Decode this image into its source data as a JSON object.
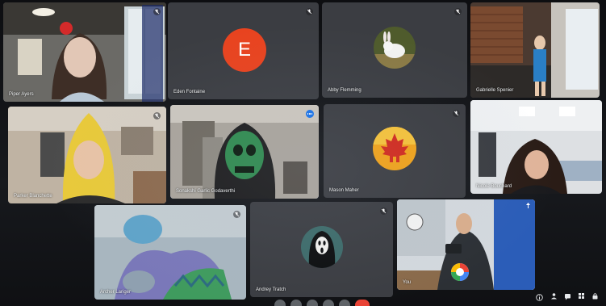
{
  "participants": [
    {
      "name": "Piper Ayers"
    },
    {
      "name": "Eden Fontaine",
      "avatar_letter": "E"
    },
    {
      "name": "Abby Flemming"
    },
    {
      "name": "Gabrielle Spenier"
    },
    {
      "name": "Parker Blanchette"
    },
    {
      "name": "Sonakshi Garlic Godaverthi"
    },
    {
      "name": "Mason Maher"
    },
    {
      "name": "Nicole Bouchard"
    },
    {
      "name": "Archer Lariger"
    },
    {
      "name": "Andrey Tratch"
    },
    {
      "name": "You"
    }
  ],
  "colors": {
    "accent": "#1a73e8",
    "avatar_orange": "#e8431f",
    "end_call_red": "#ea4335",
    "tile_bg": "#3b3d42"
  },
  "icons": [
    "mic-off-icon",
    "more-options-icon",
    "info-icon",
    "people-icon",
    "chat-icon",
    "activities-icon",
    "lock-icon",
    "pin-icon"
  ]
}
